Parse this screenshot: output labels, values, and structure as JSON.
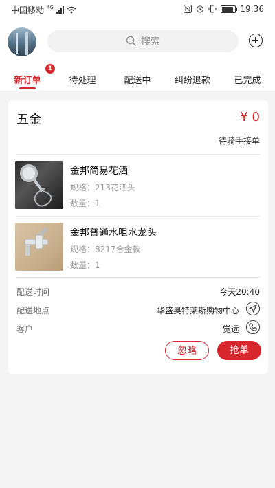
{
  "status_bar": {
    "carrier": "中国移动",
    "network": "4G",
    "time": "19:36"
  },
  "header": {
    "search_placeholder": "搜索"
  },
  "tabs": [
    {
      "label": "新订单",
      "active": true,
      "badge": "1"
    },
    {
      "label": "待处理",
      "active": false
    },
    {
      "label": "配送中",
      "active": false
    },
    {
      "label": "纠纷退款",
      "active": false
    },
    {
      "label": "已完成",
      "active": false
    }
  ],
  "order": {
    "store": "五金",
    "price": "¥ 0",
    "status": "待骑手接单",
    "items": [
      {
        "name": "金邦简易花洒",
        "spec": "规格：213花洒头",
        "qty": "数量：1"
      },
      {
        "name": "金邦普通水咀水龙头",
        "spec": "规格：8217合金款",
        "qty": "数量：1"
      }
    ],
    "delivery_time_label": "配送时间",
    "delivery_time": "今天20:40",
    "delivery_place_label": "配送地点",
    "delivery_place": "华盛奥特莱斯购物中心",
    "customer_label": "客户",
    "customer": "觉远",
    "ignore_label": "忽略",
    "grab_label": "抢单"
  },
  "colors": {
    "accent": "#d9272e",
    "background": "#f4f4f4"
  }
}
